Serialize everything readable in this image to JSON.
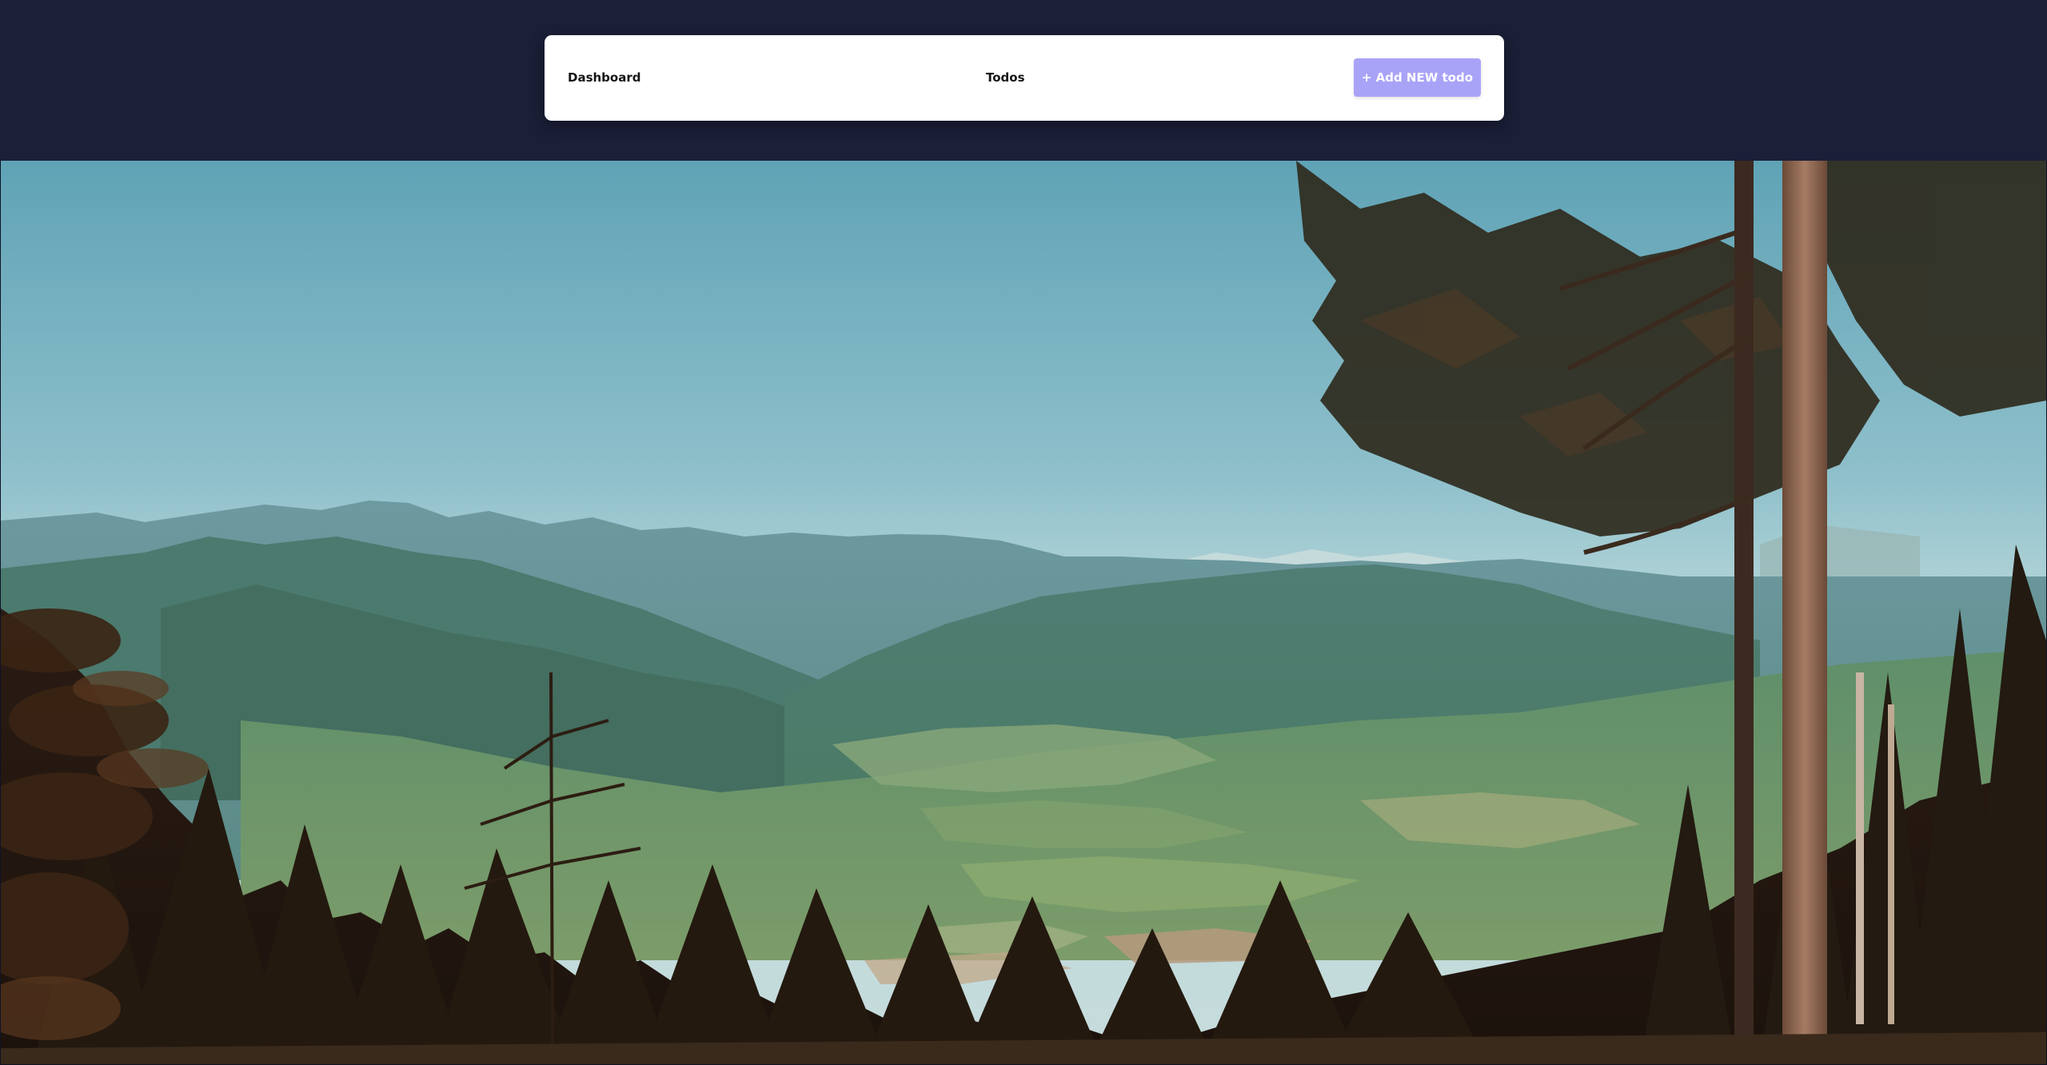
{
  "nav": {
    "dashboard_label": "Dashboard",
    "todos_label": "Todos",
    "add_button_label": "+ Add NEW todo"
  },
  "colors": {
    "header_background": "#1b1f37",
    "navbar_background": "#ffffff",
    "add_button": "#a9a3f8",
    "link_text": "#141414"
  },
  "hero": {
    "image": "mountain-valley-landscape-photo"
  }
}
